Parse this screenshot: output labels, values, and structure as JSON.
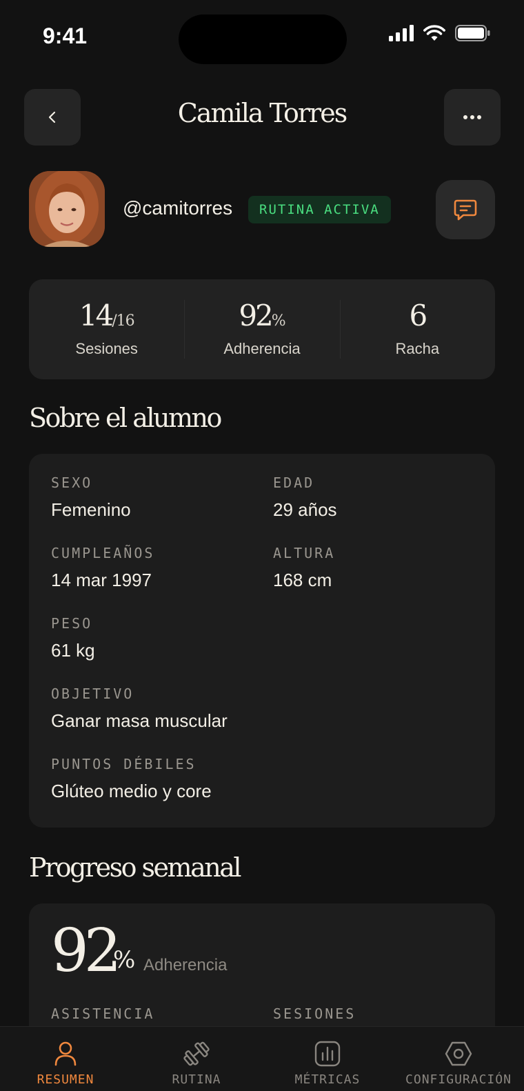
{
  "status_bar": {
    "time": "9:41"
  },
  "header": {
    "title": "Camila Torres"
  },
  "profile": {
    "username": "@camitorres",
    "badge": "RUTINA ACTIVA"
  },
  "stats": [
    {
      "value": "14",
      "suffix": "/16",
      "label": "Sesiones"
    },
    {
      "value": "92",
      "suffix": "%",
      "label": "Adherencia"
    },
    {
      "value": "6",
      "suffix": "",
      "label": "Racha"
    }
  ],
  "about": {
    "title": "Sobre el alumno",
    "fields": {
      "sexo": {
        "label": "SEXO",
        "value": "Femenino"
      },
      "edad": {
        "label": "EDAD",
        "value": "29 años"
      },
      "cumpleanos": {
        "label": "CUMPLEAÑOS",
        "value": "14 mar 1997"
      },
      "altura": {
        "label": "ALTURA",
        "value": "168 cm"
      },
      "peso": {
        "label": "PESO",
        "value": "61 kg"
      },
      "objetivo": {
        "label": "OBJETIVO",
        "value": "Ganar masa muscular"
      },
      "puntos": {
        "label": "PUNTOS DÉBILES",
        "value": "Glúteo medio y core"
      }
    }
  },
  "progress": {
    "title": "Progreso semanal",
    "value": "92",
    "suffix": "%",
    "label": "Adherencia",
    "col1_label": "ASISTENCIA",
    "col2_label": "SESIONES"
  },
  "tabs": [
    {
      "label": "RESUMEN",
      "icon": "user-icon",
      "active": true
    },
    {
      "label": "RUTINA",
      "icon": "dumbbell-icon",
      "active": false
    },
    {
      "label": "MÉTRICAS",
      "icon": "bar-chart-icon",
      "active": false
    },
    {
      "label": "CONFIGURACIÓN",
      "icon": "settings-icon",
      "active": false
    }
  ],
  "colors": {
    "accent": "#f0883e",
    "badge_green": "#4ade80",
    "background": "#121212",
    "card": "#1d1d1d"
  }
}
